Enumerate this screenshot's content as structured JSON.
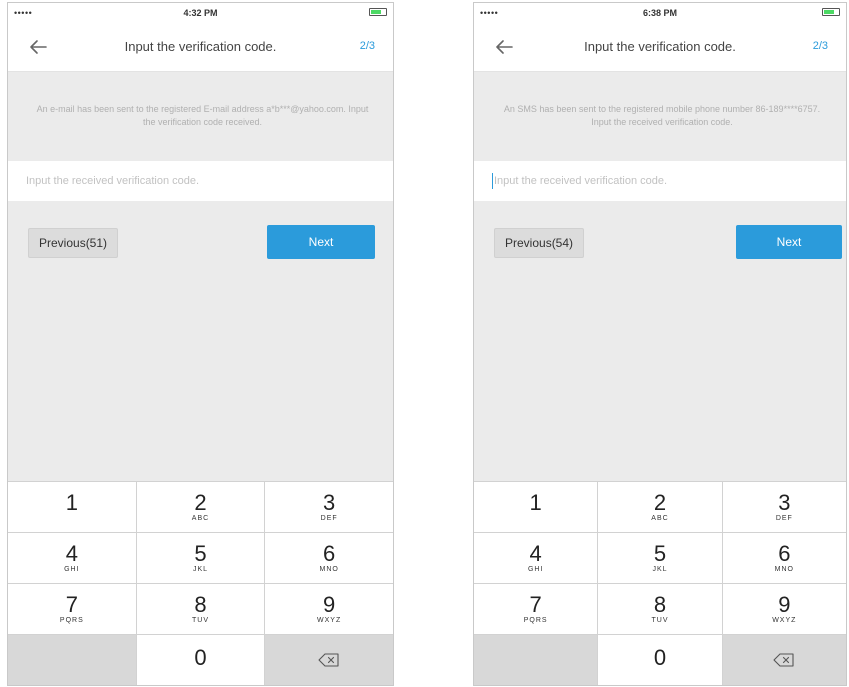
{
  "screens": [
    {
      "status_bar": {
        "carrier": "•••••",
        "time": "4:32 PM"
      },
      "nav": {
        "title": "Input the verification code.",
        "step": "2/3"
      },
      "info_text": "An e-mail has been sent to the registered E-mail address a*b***@yahoo.com. Input the verification code received.",
      "code_input": {
        "value": "",
        "placeholder": "Input the received verification code."
      },
      "buttons": {
        "previous": "Previous(51)",
        "next": "Next"
      }
    },
    {
      "status_bar": {
        "carrier": "•••••",
        "time": "6:38 PM"
      },
      "nav": {
        "title": "Input the verification code.",
        "step": "2/3"
      },
      "info_text": "An SMS has been sent to the registered mobile phone number 86-189****6757. Input the received verification code.",
      "code_input": {
        "value": "",
        "placeholder": "Input the received verification code."
      },
      "buttons": {
        "previous": "Previous(54)",
        "next": "Next"
      }
    }
  ],
  "keypad": {
    "keys": [
      {
        "num": "1",
        "letters": ""
      },
      {
        "num": "2",
        "letters": "ABC"
      },
      {
        "num": "3",
        "letters": "DEF"
      },
      {
        "num": "4",
        "letters": "GHI"
      },
      {
        "num": "5",
        "letters": "JKL"
      },
      {
        "num": "6",
        "letters": "MNO"
      },
      {
        "num": "7",
        "letters": "PQRS"
      },
      {
        "num": "8",
        "letters": "TUV"
      },
      {
        "num": "9",
        "letters": "WXYZ"
      },
      {
        "num": "0",
        "letters": ""
      }
    ],
    "delete_icon": "backspace-icon"
  },
  "colors": {
    "accent": "#2b9bdb",
    "background": "#ebebeb",
    "battery": "#4cd964"
  }
}
